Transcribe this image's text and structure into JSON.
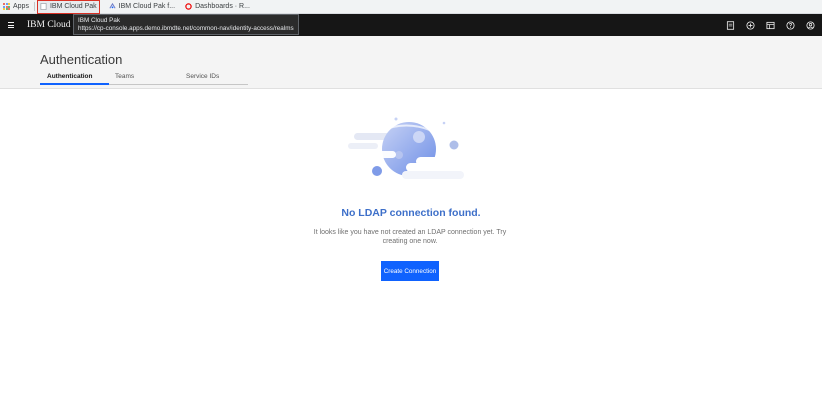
{
  "bookmarks": {
    "apps_label": "Apps",
    "items": [
      {
        "label": "IBM Cloud Pak",
        "icon": "page-icon",
        "active": true
      },
      {
        "label": "IBM Cloud Pak f...",
        "icon": "cloud-pak-icon"
      },
      {
        "label": "Dashboards · R...",
        "icon": "openshift-icon"
      }
    ]
  },
  "tooltip": {
    "title": "IBM Cloud Pak",
    "url": "https://cp-console.apps.demo.ibmdte.net/common-nav/identity-access/realms"
  },
  "header": {
    "brand": "IBM Cloud Pak",
    "actions": [
      "docs-icon",
      "add-icon",
      "catalog-icon",
      "help-icon",
      "user-icon"
    ]
  },
  "page": {
    "title": "Authentication",
    "tabs": [
      {
        "label": "Authentication",
        "active": true
      },
      {
        "label": "Teams",
        "active": false
      },
      {
        "label": "Service IDs",
        "active": false
      }
    ]
  },
  "empty_state": {
    "title": "No LDAP connection found.",
    "description": "It looks like you have not created an LDAP connection yet. Try creating one now.",
    "button_label": "Create Connection"
  },
  "colors": {
    "masthead": "#161616",
    "accent": "#0f62fe",
    "empty_title": "#3d6fc9"
  }
}
